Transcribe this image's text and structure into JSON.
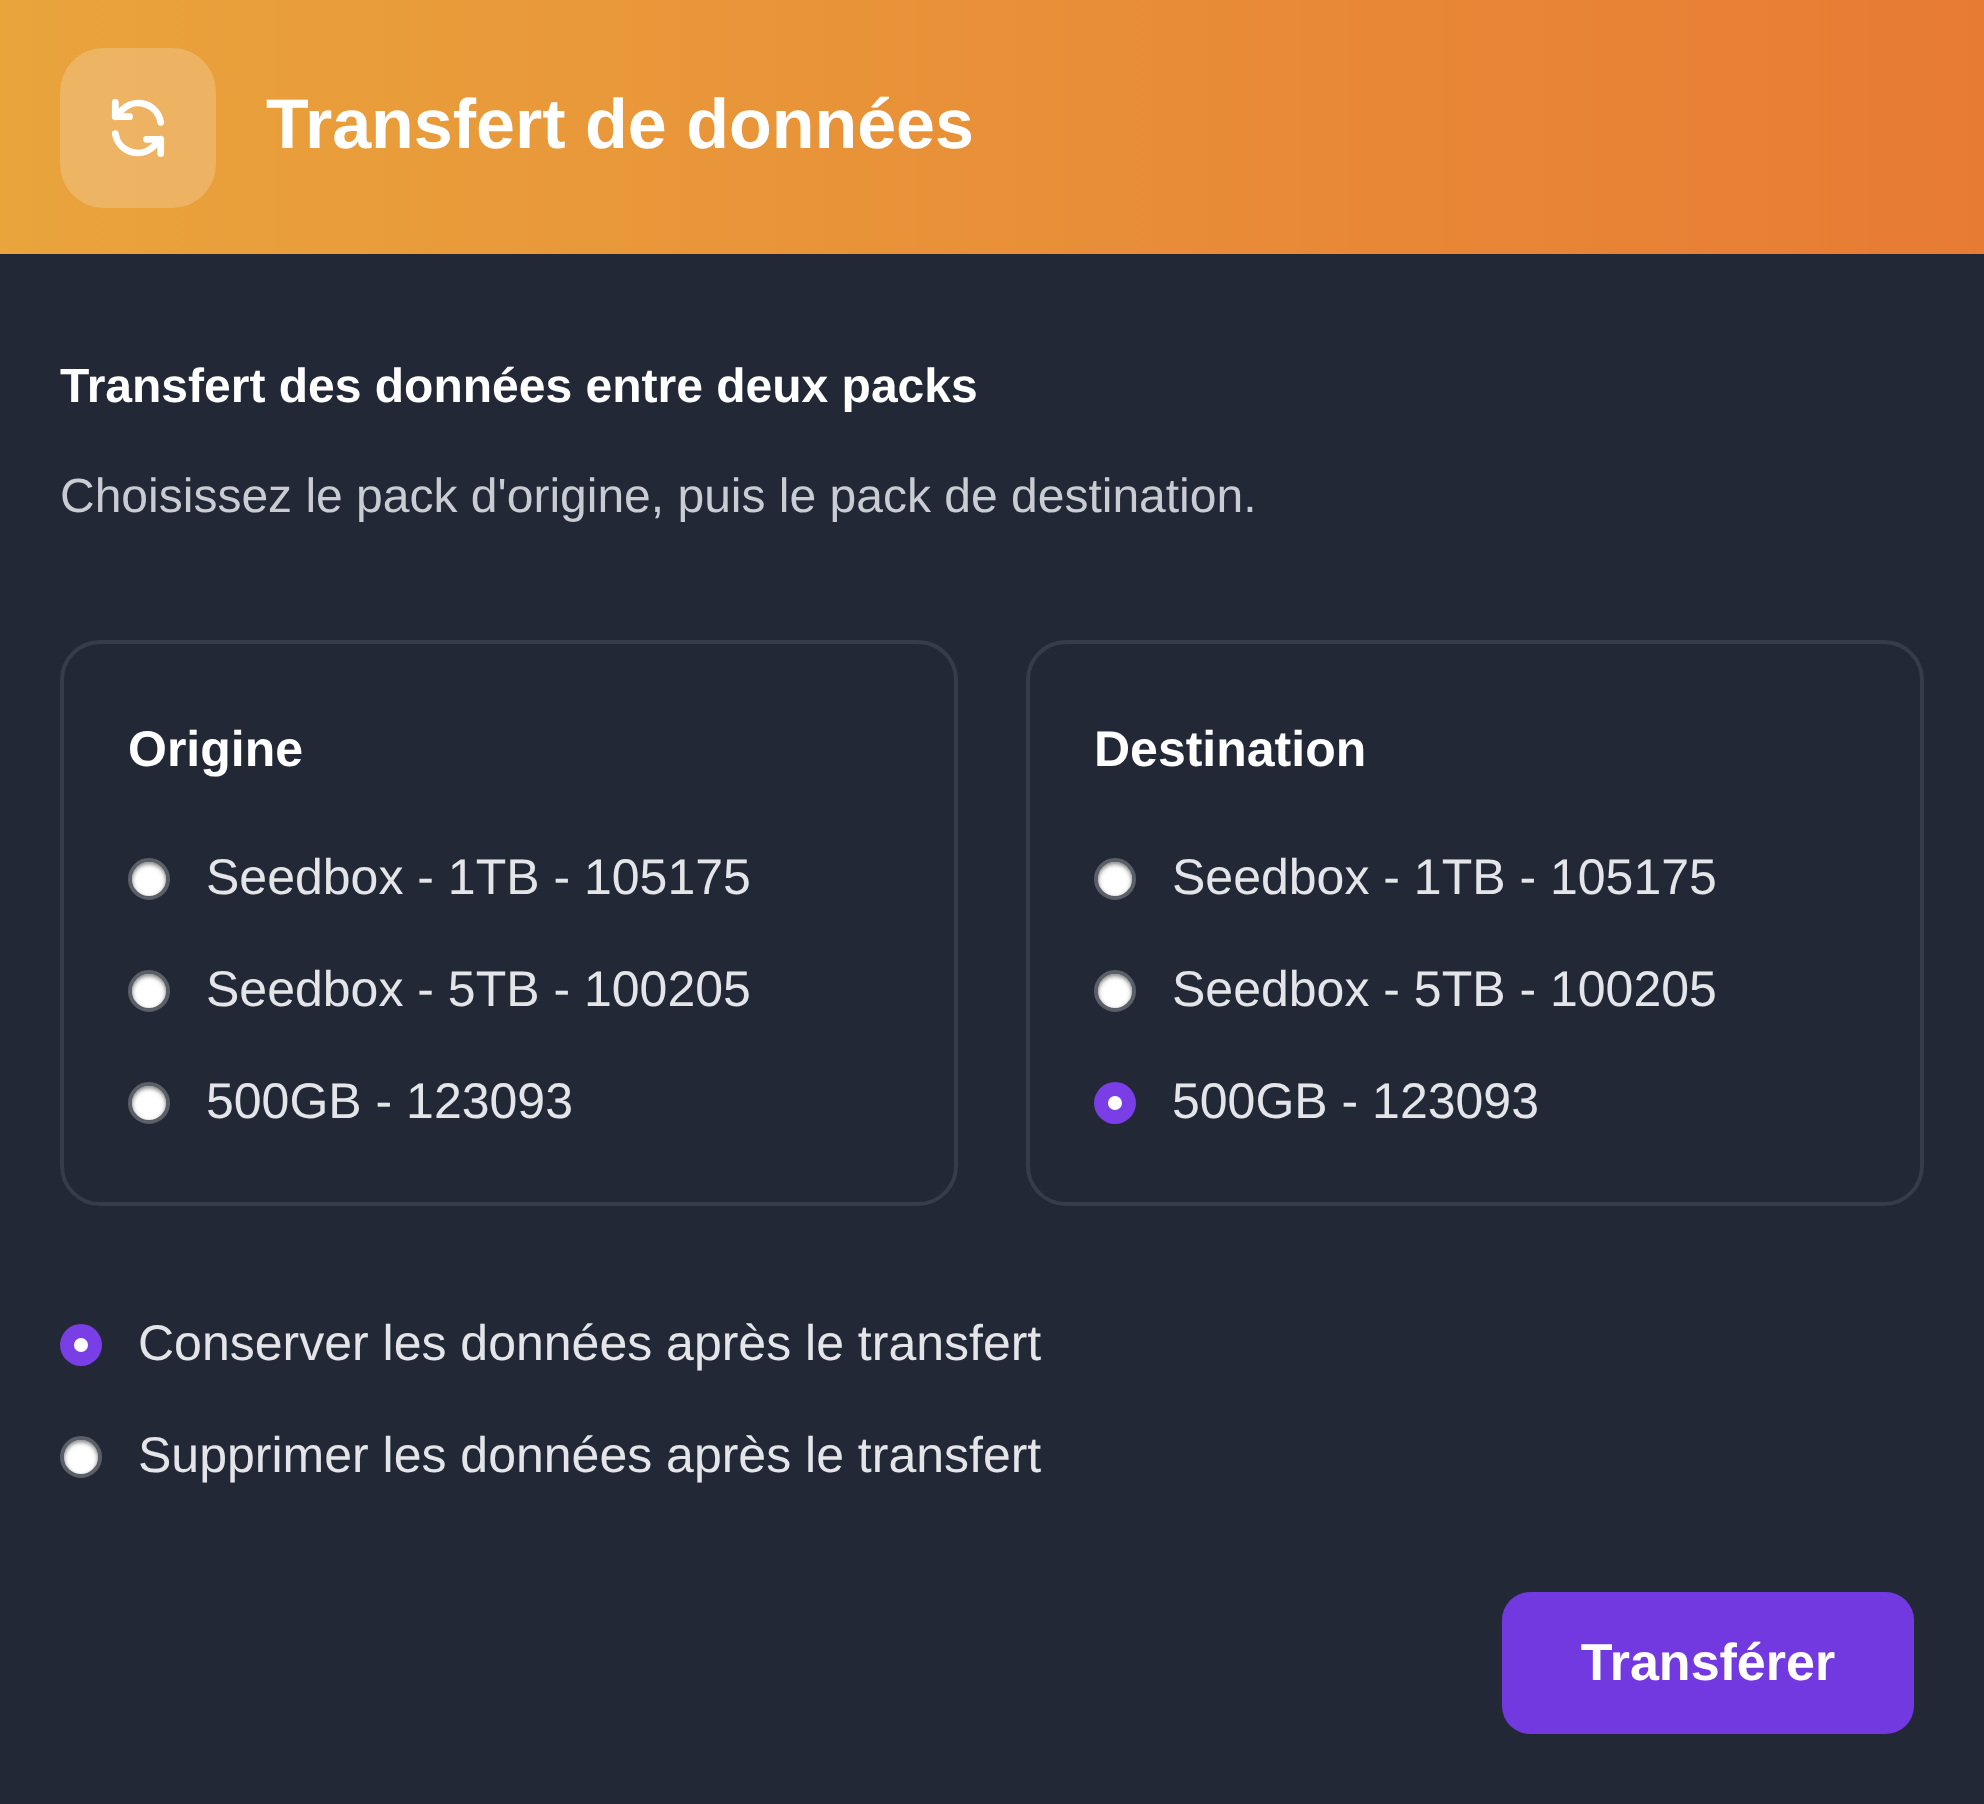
{
  "header": {
    "title": "Transfert de données"
  },
  "section": {
    "title": "Transfert des données entre deux packs",
    "description": "Choisissez le pack d'origine, puis le pack de destination."
  },
  "packs": [
    {
      "heading": "Origine",
      "options": [
        {
          "label": "Seedbox - 1TB - 105175",
          "selected": false
        },
        {
          "label": "Seedbox - 5TB - 100205",
          "selected": false
        },
        {
          "label": "500GB - 123093",
          "selected": false
        }
      ]
    },
    {
      "heading": "Destination",
      "options": [
        {
          "label": "Seedbox - 1TB - 105175",
          "selected": false
        },
        {
          "label": "Seedbox - 5TB - 100205",
          "selected": false
        },
        {
          "label": "500GB - 123093",
          "selected": true
        }
      ]
    }
  ],
  "after_transfer": [
    {
      "label": "Conserver les données après le transfert",
      "selected": true
    },
    {
      "label": "Supprimer les données après le transfert",
      "selected": false
    }
  ],
  "submit_button": {
    "label": "Transférer"
  }
}
